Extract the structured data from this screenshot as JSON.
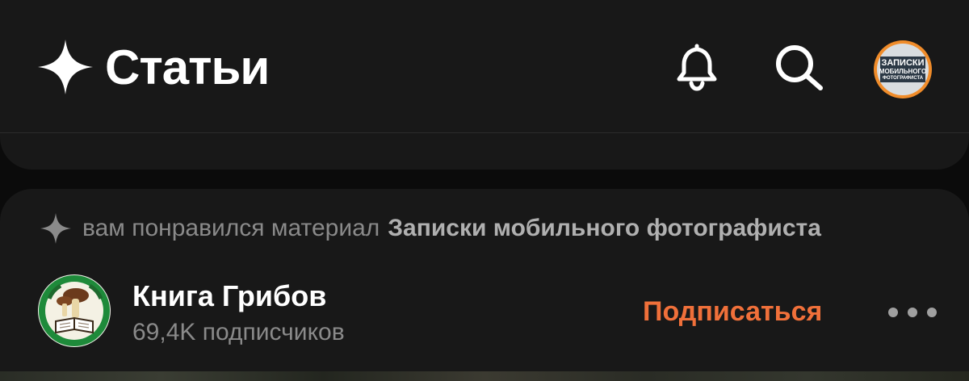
{
  "header": {
    "title": "Статьи",
    "icons": [
      "sparkle-icon",
      "bell-icon",
      "search-icon"
    ],
    "avatar": {
      "line1": "ЗАПИСКИ",
      "line2": "МОБИЛЬНОГО",
      "line3": "ФОТОГРАФИСТА"
    }
  },
  "feed_item": {
    "liked_prefix": "вам понравился материал",
    "liked_source": "Записки мобильного фотографиста",
    "channel": {
      "name": "Книга Грибов",
      "subscribers": "69,4K подписчиков",
      "avatar_text": "Книга Грибов"
    },
    "subscribe_label": "Подписаться",
    "more_icon": "more-horizontal-icon"
  },
  "colors": {
    "background": "#0b0b0b",
    "surface": "#181818",
    "accent": "#f0703a",
    "text_primary": "#ffffff",
    "text_secondary": "#8a8a8a"
  }
}
